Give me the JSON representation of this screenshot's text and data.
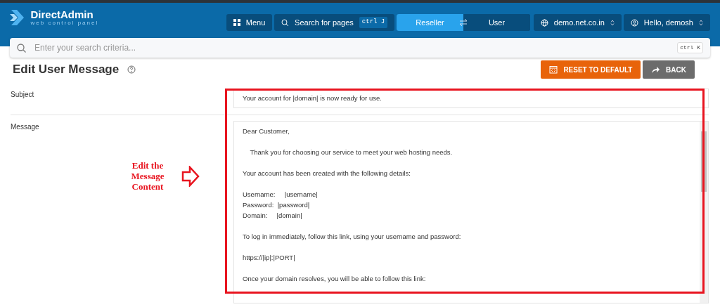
{
  "header": {
    "logo_title": "DirectAdmin",
    "logo_subtitle": "web control panel",
    "menu_button": "Menu",
    "page_search": {
      "label": "Search for pages",
      "shortcut": "ctrl J"
    },
    "role_switch": [
      {
        "label": "Reseller",
        "selected": true
      },
      {
        "label": "User",
        "selected": false
      }
    ],
    "domain_select": "demo.net.co.in",
    "user_select": "Hello, demosh"
  },
  "search": {
    "placeholder": "Enter your search criteria...",
    "shortcut": "ctrl K"
  },
  "page_title": "Edit User Message",
  "actions": [
    {
      "kind": "reset",
      "label": "RESET TO DEFAULT"
    },
    {
      "kind": "back",
      "label": "BACK"
    }
  ],
  "form": {
    "subject": {
      "label": "Subject",
      "value": "Your account for |domain| is now ready for use."
    },
    "message": {
      "label": "Message",
      "paragraphs": [
        [
          "Dear Customer,"
        ],
        [
          "    Thank you for choosing our service to meet your web hosting needs."
        ],
        [
          "Your account has been created with the following details:"
        ],
        [
          "Username:     |username|",
          "Password:  |password|",
          "Domain:     |domain|"
        ],
        [
          "To log in immediately, follow this link, using your username and password:"
        ],
        [
          "https://|ip|:|PORT|"
        ],
        [
          "Once your domain resolves, you will be able to follow this link:"
        ]
      ]
    }
  },
  "annotation": {
    "text": "Edit the Message Content"
  }
}
